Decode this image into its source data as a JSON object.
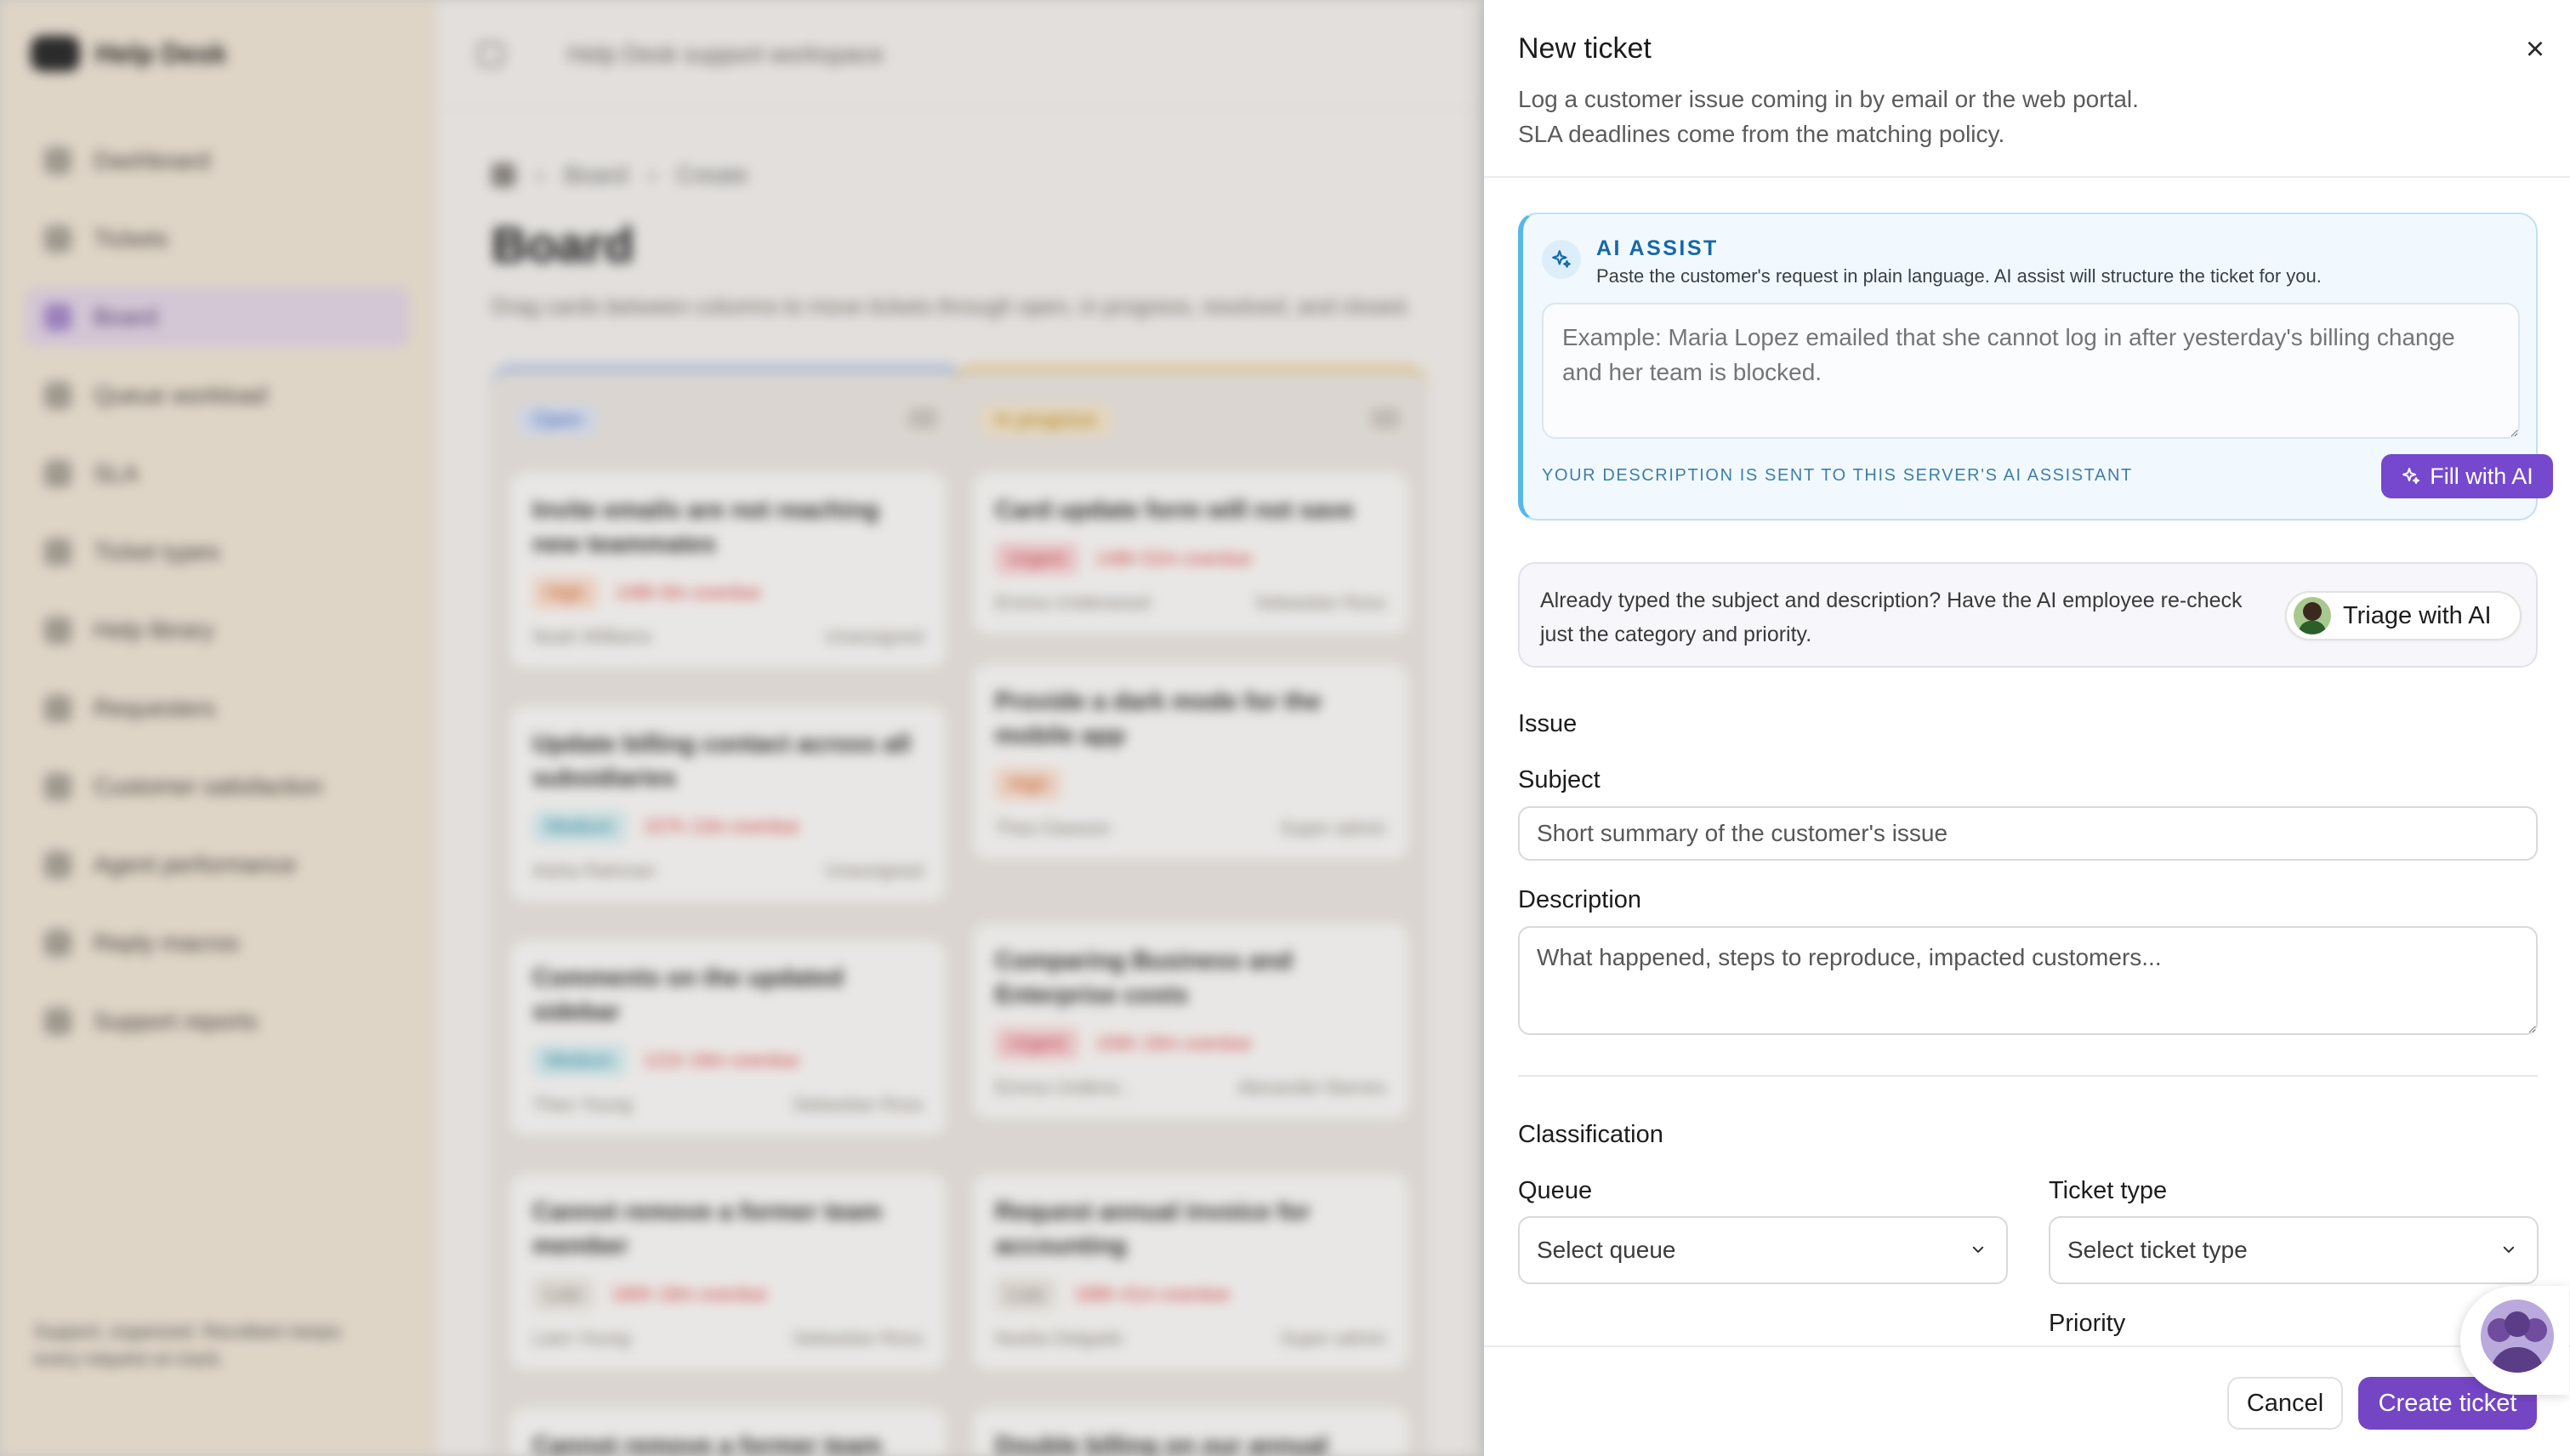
{
  "background": {
    "brand": "Help Desk",
    "topbar_text": "Help Desk support workspace",
    "nav": [
      "Dashboard",
      "Tickets",
      "Board",
      "Queue workload",
      "SLA",
      "Ticket types",
      "Help library",
      "Requesters",
      "Customer satisfaction",
      "Agent performance",
      "Reply macros",
      "Support reports"
    ],
    "breadcrumb": [
      "Board",
      "Create"
    ],
    "page_title": "Board",
    "page_subtitle": "Drag cards between columns to move tickets through open, in progress, resolved, and closed.",
    "sidebar_footer": "Support, organized. Recolleen keeps every request on track.",
    "columns": [
      {
        "name": "Open",
        "cards": [
          {
            "title": "Invite emails are not reaching new teammates",
            "priority": "High",
            "due": "148h 8m overdue",
            "requester": "Noah Williams",
            "assignee": "Unassigned"
          },
          {
            "title": "Update billing contact across all subsidiaries",
            "priority": "Medium",
            "due": "157h 13m overdue",
            "requester": "Aisha Rahman",
            "assignee": "Unassigned"
          },
          {
            "title": "Comments on the updated sidebar",
            "priority": "Medium",
            "due": "121h 18m overdue",
            "requester": "Theo Young",
            "assignee": "Sebastian Ross"
          },
          {
            "title": "Cannot remove a former team member",
            "priority": "Low",
            "due": "180h 18m overdue",
            "requester": "Liam Young",
            "assignee": "Sebastian Ross"
          },
          {
            "title": "Cannot remove a former team member",
            "priority": "",
            "due": "",
            "requester": "",
            "assignee": ""
          }
        ]
      },
      {
        "name": "In progress",
        "cards": [
          {
            "title": "Card update form will not save",
            "priority": "Urgent",
            "due": "148h 52m overdue",
            "requester": "Emma Underwood",
            "assignee": "Sebastian Ross"
          },
          {
            "title": "Provide a dark mode for the mobile app",
            "priority": "High",
            "due": "",
            "requester": "Theo Dawson",
            "assignee": "Super admin"
          },
          {
            "title": "Comparing Business and Enterprise costs",
            "priority": "Urgent",
            "due": "156h 18m overdue",
            "requester": "Emma Underw...",
            "assignee": "Alexander Barnes"
          },
          {
            "title": "Request annual invoice for accounting",
            "priority": "Low",
            "due": "188h 41m overdue",
            "requester": "Noelia Delgado",
            "assignee": "Super admin"
          },
          {
            "title": "Double billing on our annual renewal",
            "priority": "",
            "due": "",
            "requester": "",
            "assignee": ""
          }
        ]
      }
    ]
  },
  "drawer": {
    "title": "New ticket",
    "subtitle": "Log a customer issue coming in by email or the web portal. SLA deadlines come from the matching policy.",
    "close_icon": "×",
    "ai": {
      "label": "AI ASSIST",
      "hint": "Paste the customer's request in plain language. AI assist will structure the ticket for you.",
      "placeholder": "Example: Maria Lopez emailed that she cannot log in after yesterday's billing change and her team is blocked.",
      "note": "YOUR DESCRIPTION IS SENT TO THIS SERVER'S AI ASSISTANT",
      "button": "Fill with AI"
    },
    "triage": {
      "text": "Already typed the subject and description? Have the AI employee re-check just the category and priority.",
      "button": "Triage with AI"
    },
    "issue": {
      "section": "Issue",
      "subject_label": "Subject",
      "subject_placeholder": "Short summary of the customer's issue",
      "description_label": "Description",
      "description_placeholder": "What happened, steps to reproduce, impacted customers..."
    },
    "classification": {
      "section": "Classification",
      "queue_label": "Queue",
      "queue_value": "Select queue",
      "type_label": "Ticket type",
      "type_value": "Select ticket type",
      "priority_label": "Priority"
    },
    "footer": {
      "cancel": "Cancel",
      "create": "Create ticket"
    }
  },
  "colors": {
    "accent": "#7446c4",
    "ai_border": "#57b8e8",
    "ai_label": "#1569a8"
  }
}
